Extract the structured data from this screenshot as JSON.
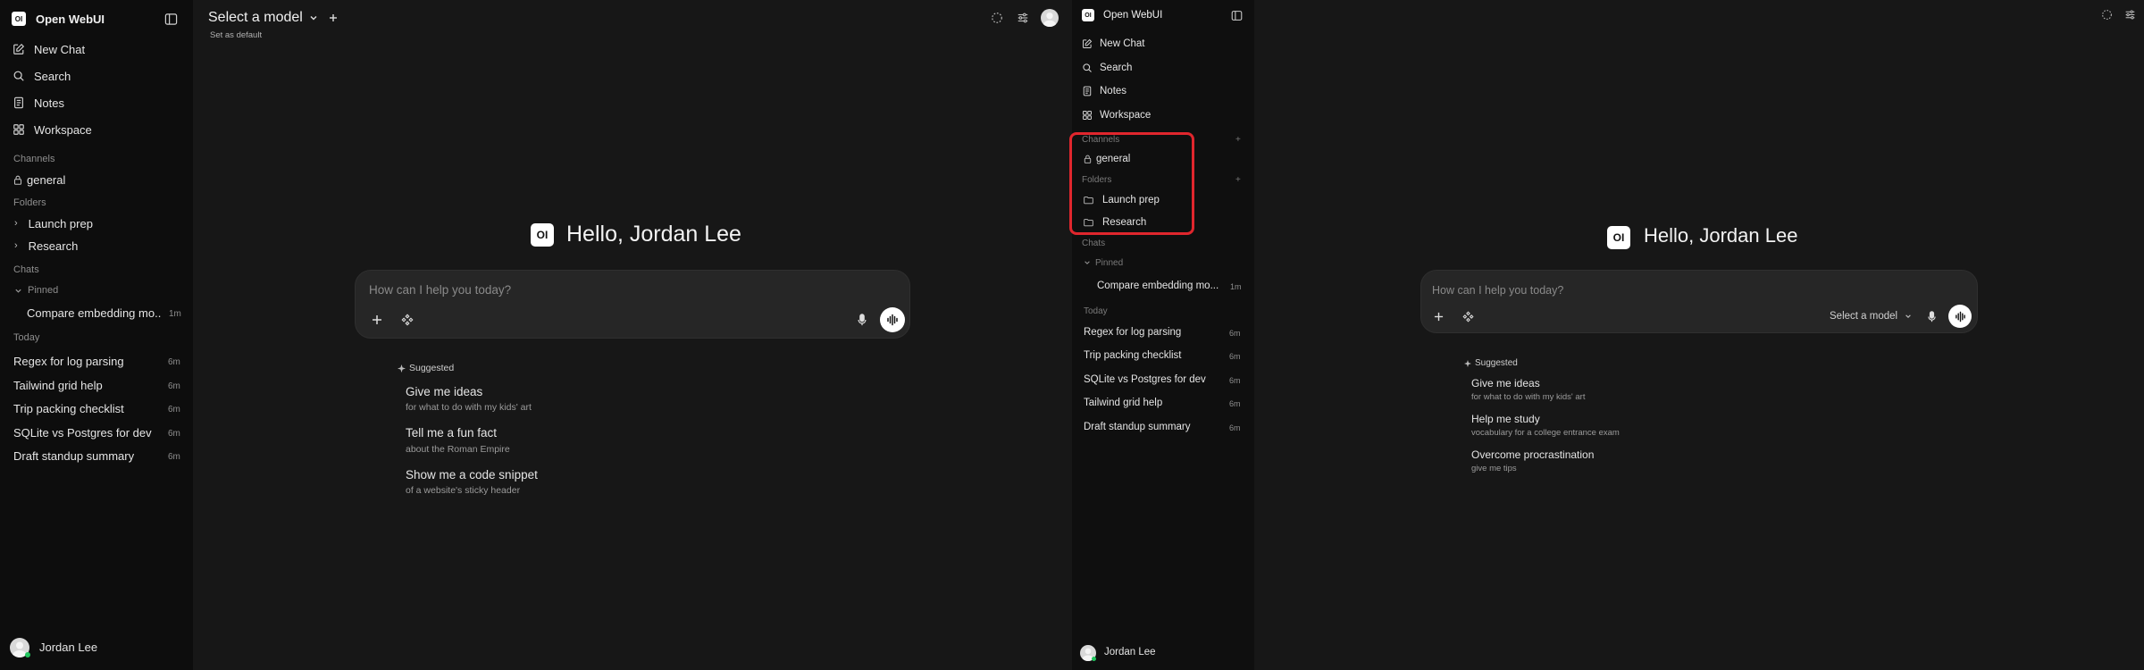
{
  "left_sidebar": {
    "app_name": "Open WebUI",
    "logo_text": "OI",
    "nav": [
      {
        "label": "New Chat",
        "icon": "pencil-square-icon"
      },
      {
        "label": "Search",
        "icon": "search-icon"
      },
      {
        "label": "Notes",
        "icon": "notes-icon"
      },
      {
        "label": "Workspace",
        "icon": "grid-icon"
      }
    ],
    "channels_heading": "Channels",
    "channel": "general",
    "folders_heading": "Folders",
    "folders": [
      "Launch prep",
      "Research"
    ],
    "chats_heading": "Chats",
    "pinned_heading": "Pinned",
    "pinned_chat": {
      "title": "Compare embedding mo...",
      "time": "1m"
    },
    "today_heading": "Today",
    "chats": [
      {
        "title": "Regex for log parsing",
        "time": "6m"
      },
      {
        "title": "Tailwind grid help",
        "time": "6m"
      },
      {
        "title": "Trip packing checklist",
        "time": "6m"
      },
      {
        "title": "SQLite vs Postgres for dev",
        "time": "6m"
      },
      {
        "title": "Draft standup summary",
        "time": "6m"
      }
    ],
    "user_name": "Jordan Lee"
  },
  "left_main": {
    "model_selector": "Select a model",
    "set_default": "Set as default",
    "greeting": "Hello, Jordan Lee",
    "logo_text": "OI",
    "input_placeholder": "How can I help you today?",
    "suggested_label": "Suggested",
    "suggestions": [
      {
        "title": "Give me ideas",
        "subtitle": "for what to do with my kids' art"
      },
      {
        "title": "Tell me a fun fact",
        "subtitle": "about the Roman Empire"
      },
      {
        "title": "Show me a code snippet",
        "subtitle": "of a website's sticky header"
      }
    ]
  },
  "right_sidebar": {
    "app_name": "Open WebUI",
    "logo_text": "OI",
    "nav": [
      {
        "label": "New Chat"
      },
      {
        "label": "Search"
      },
      {
        "label": "Notes"
      },
      {
        "label": "Workspace"
      }
    ],
    "channels_heading": "Channels",
    "channel": "general",
    "folders_heading": "Folders",
    "folders": [
      "Launch prep",
      "Research"
    ],
    "chats_heading": "Chats",
    "pinned_heading": "Pinned",
    "pinned_chat": {
      "title": "Compare embedding mo...",
      "time": "1m"
    },
    "today_heading": "Today",
    "chats": [
      {
        "title": "Regex for log parsing",
        "time": "6m"
      },
      {
        "title": "Trip packing checklist",
        "time": "6m"
      },
      {
        "title": "SQLite vs Postgres for dev",
        "time": "6m"
      },
      {
        "title": "Tailwind grid help",
        "time": "6m"
      },
      {
        "title": "Draft standup summary",
        "time": "6m"
      }
    ],
    "user_name": "Jordan Lee",
    "highlight_color": "#e0262d"
  },
  "right_main": {
    "greeting": "Hello, Jordan Lee",
    "logo_text": "OI",
    "input_placeholder": "How can I help you today?",
    "model_selector": "Select a model",
    "suggested_label": "Suggested",
    "suggestions": [
      {
        "title": "Give me ideas",
        "subtitle": "for what to do with my kids' art"
      },
      {
        "title": "Help me study",
        "subtitle": "vocabulary for a college entrance exam"
      },
      {
        "title": "Overcome procrastination",
        "subtitle": "give me tips"
      }
    ]
  }
}
